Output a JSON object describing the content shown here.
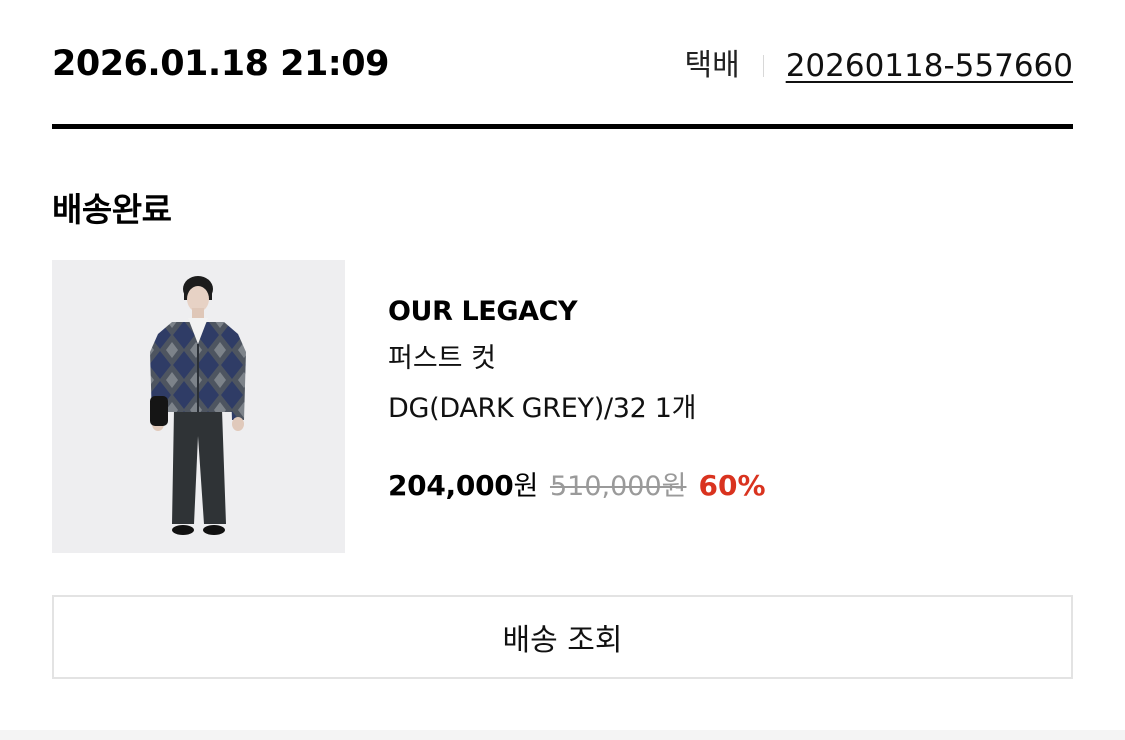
{
  "order": {
    "date": "2026.01.18 21:09",
    "shipping_method": "택배",
    "order_number": "20260118-557660"
  },
  "status": "배송완료",
  "product": {
    "brand": "OUR LEGACY",
    "name": "퍼스트 컷",
    "option": "DG(DARK GREY)/32 1개",
    "sale_price": "204,000",
    "currency": "원",
    "original_price": "510,000원",
    "discount": "60%"
  },
  "actions": {
    "track_label": "배송 조회"
  },
  "colors": {
    "discount": "#d9331f",
    "header_rule": "#000000",
    "button_border": "#e3e3e3"
  },
  "icons": {
    "product_image": "model-wearing-argyle-cardigan"
  }
}
